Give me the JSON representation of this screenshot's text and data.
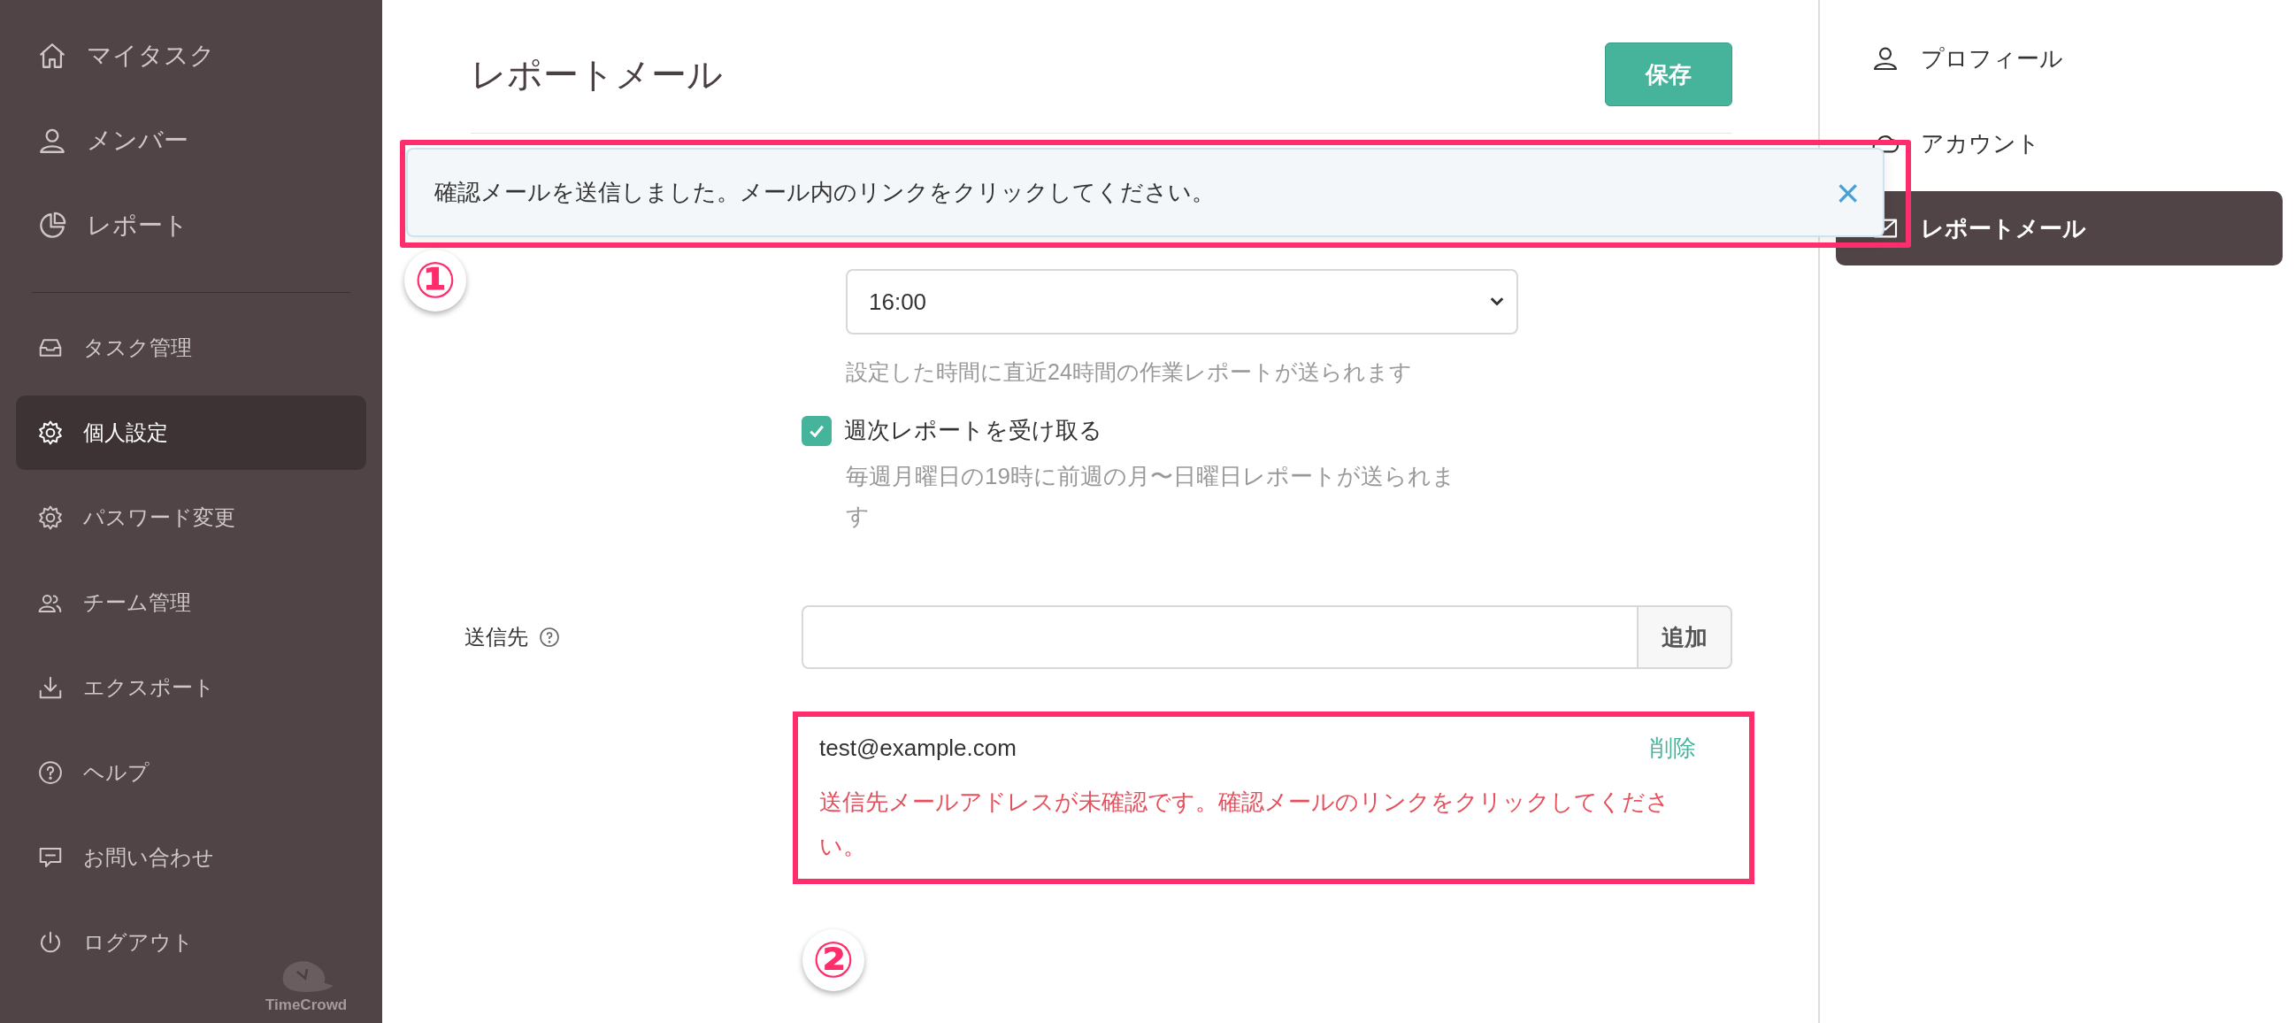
{
  "sidebar": {
    "primary": [
      {
        "label": "マイタスク",
        "selected": false
      },
      {
        "label": "メンバー",
        "selected": false
      },
      {
        "label": "レポート",
        "selected": false
      }
    ],
    "secondary": [
      {
        "label": "タスク管理",
        "selected": false
      },
      {
        "label": "個人設定",
        "selected": true
      },
      {
        "label": "パスワード変更",
        "selected": false
      },
      {
        "label": "チーム管理",
        "selected": false
      },
      {
        "label": "エクスポート",
        "selected": false
      },
      {
        "label": "ヘルプ",
        "selected": false
      },
      {
        "label": "お問い合わせ",
        "selected": false
      },
      {
        "label": "ログアウト",
        "selected": false
      }
    ],
    "logo": "TimeCrowd"
  },
  "page": {
    "title": "レポートメール",
    "save_button": "保存"
  },
  "toast": {
    "message": "確認メールを送信しました。メール内のリンクをクリックしてください。",
    "close": "×"
  },
  "daily": {
    "time": "16:00",
    "hint": "設定した時間に直近24時間の作業レポートが送られます"
  },
  "weekly": {
    "label": "週次レポートを受け取る",
    "checked": true,
    "hint": "毎週月曜日の19時に前週の月〜日曜日レポートが送られます"
  },
  "recipients": {
    "label": "送信先",
    "add_button": "追加",
    "entries": [
      {
        "email": "test@example.com",
        "delete": "削除",
        "error": "送信先メールアドレスが未確認です。確認メールのリンクをクリックしてください。"
      }
    ]
  },
  "annotations": [
    {
      "label": "①"
    },
    {
      "label": "②"
    }
  ],
  "settings_menu": [
    {
      "label": "プロフィール",
      "selected": false
    },
    {
      "label": "アカウント",
      "selected": false
    },
    {
      "label": "レポートメール",
      "selected": true
    }
  ]
}
